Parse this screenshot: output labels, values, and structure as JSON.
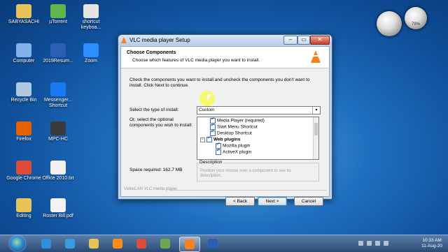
{
  "desktop_icons": [
    {
      "label": "SABYASACHI",
      "icon": "folder-icon",
      "color": "#e8c35a"
    },
    {
      "label": "µTorrent",
      "icon": "utorrent-icon",
      "color": "#5fb54a"
    },
    {
      "label": "shortcut keyboa...",
      "icon": "document-icon",
      "color": "#e6e6e6"
    },
    {
      "label": "Computer",
      "icon": "computer-icon",
      "color": "#7fb2e6"
    },
    {
      "label": "2019Resum...",
      "icon": "word-icon",
      "color": "#2b5fb4"
    },
    {
      "label": "Zoom",
      "icon": "zoom-icon",
      "color": "#2d8cff"
    },
    {
      "label": "Recycle Bin",
      "icon": "recycle-bin-icon",
      "color": "#b0c8e0"
    },
    {
      "label": "Messenger... Shortcut",
      "icon": "messenger-icon",
      "color": "#1877f2"
    },
    {
      "label": "Firefox",
      "icon": "firefox-icon",
      "color": "#e66000"
    },
    {
      "label": "MPC-HC",
      "icon": "mpc-icon",
      "color": "#3a3a3a"
    },
    {
      "label": "Google Chrome",
      "icon": "chrome-icon",
      "color": "#dd4b39"
    },
    {
      "label": "Office 2010.txt",
      "icon": "text-file-icon",
      "color": "#f0f0f0"
    },
    {
      "label": "Editing",
      "icon": "folder-icon",
      "color": "#e8c35a"
    },
    {
      "label": "Roster Bill.pdf",
      "icon": "pdf-icon",
      "color": "#f2f2f2"
    }
  ],
  "gadgets": {
    "cpu": "",
    "meter": "78%"
  },
  "window": {
    "title": "VLC media player Setup",
    "minimize": "–",
    "maximize": "▭",
    "close": "✕",
    "heading": "Choose Components",
    "subheading": "Choose which features of VLC media player you want to install.",
    "instructions": "Check the components you want to install and uncheck the components you don't want to install. Click Next to continue.",
    "type_label": "Select the type of install:",
    "type_value": "Custom",
    "optional_label": "Or, select the optional components you wish to install:",
    "space_label": "Space required: 162.7 MB",
    "components": [
      {
        "label": "Media Player (required)",
        "checked": true,
        "bold": false
      },
      {
        "label": "Start Menu Shortcut",
        "checked": true,
        "bold": false
      },
      {
        "label": "Desktop Shortcut",
        "checked": true,
        "bold": false
      },
      {
        "label": "Web plugins",
        "checked": true,
        "bold": true
      },
      {
        "label": "Mozilla plugin",
        "checked": true,
        "bold": false
      },
      {
        "label": "ActiveX plugin",
        "checked": true,
        "bold": false
      }
    ],
    "description_title": "Description",
    "description_text": "Position your mouse over a component to see its description.",
    "brand": "VideoLAN VLC media player",
    "back_button": "< Back",
    "next_button": "Next >",
    "cancel_button": "Cancel"
  },
  "taskbar": {
    "items": [
      {
        "icon": "explorer-icon",
        "color": "#2f8fd8",
        "active": false
      },
      {
        "icon": "ie-icon",
        "color": "#3a9be0",
        "active": false
      },
      {
        "icon": "folder-icon",
        "color": "#e8c35a",
        "active": false
      },
      {
        "icon": "media-player-icon",
        "color": "#ff8c1a",
        "active": false
      },
      {
        "icon": "chrome-icon",
        "color": "#dd4b39",
        "active": false
      },
      {
        "icon": "paint-icon",
        "color": "#6aa84f",
        "active": false
      },
      {
        "icon": "vlc-icon",
        "color": "#f58220",
        "active": true
      },
      {
        "icon": "word-icon",
        "color": "#2b5fb4",
        "active": false
      }
    ],
    "time": "10:33 AM",
    "date": "11-Aug-20"
  }
}
